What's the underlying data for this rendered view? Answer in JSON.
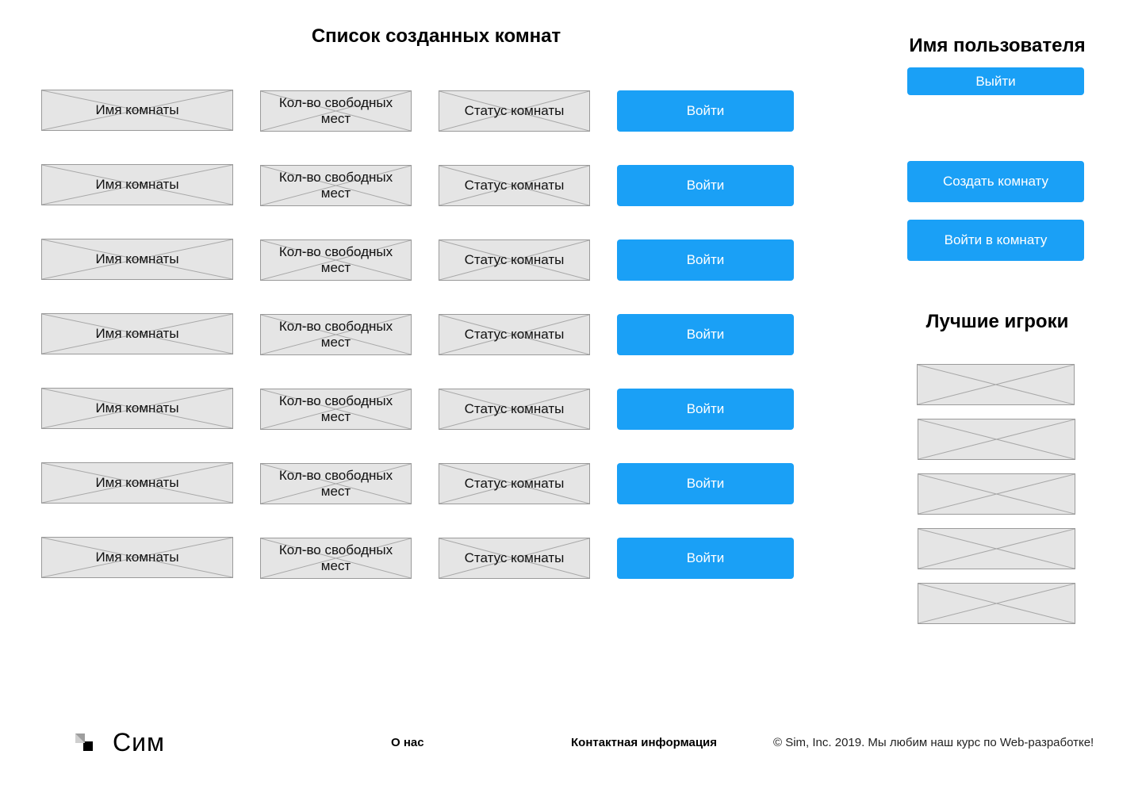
{
  "rooms_section": {
    "title": "Список созданных комнат",
    "rows": [
      {
        "name": "Имя комнаты",
        "free_places": "Кол-во свободных мест",
        "status": "Статус комнаты",
        "join_label": "Войти"
      },
      {
        "name": "Имя комнаты",
        "free_places": "Кол-во свободных мест",
        "status": "Статус комнаты",
        "join_label": "Войти"
      },
      {
        "name": "Имя комнаты",
        "free_places": "Кол-во свободных мест",
        "status": "Статус комнаты",
        "join_label": "Войти"
      },
      {
        "name": "Имя комнаты",
        "free_places": "Кол-во свободных мест",
        "status": "Статус комнаты",
        "join_label": "Войти"
      },
      {
        "name": "Имя комнаты",
        "free_places": "Кол-во свободных мест",
        "status": "Статус комнаты",
        "join_label": "Войти"
      },
      {
        "name": "Имя комнаты",
        "free_places": "Кол-во свободных мест",
        "status": "Статус комнаты",
        "join_label": "Войти"
      },
      {
        "name": "Имя комнаты",
        "free_places": "Кол-во свободных мест",
        "status": "Статус комнаты",
        "join_label": "Войти"
      }
    ]
  },
  "user_panel": {
    "username": "Имя пользователя",
    "logout_label": "Выйти",
    "create_room_label": "Создать комнату",
    "join_room_label": "Войти в комнату"
  },
  "top_players": {
    "title": "Лучшие игроки",
    "count": 5
  },
  "footer": {
    "logo_text": "Сим",
    "about_label": "О нас",
    "contacts_label": "Контактная информация",
    "copyright": "© Sim, Inc. 2019. Мы любим наш курс по Web-разработке!"
  },
  "colors": {
    "accent": "#1aa0f6",
    "placeholder_bg": "#e5e5e5",
    "placeholder_border": "#9a9a9a"
  }
}
